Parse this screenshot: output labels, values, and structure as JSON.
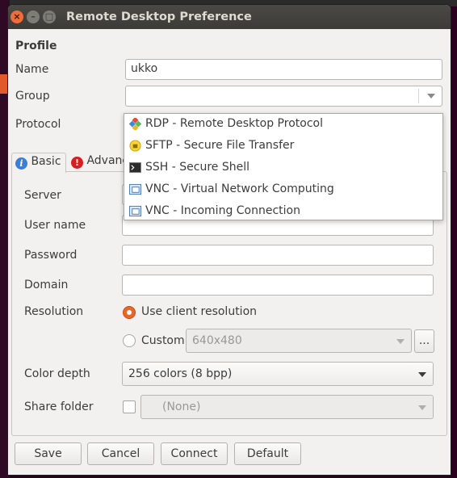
{
  "window": {
    "title": "Remote Desktop Preference"
  },
  "window_controls": {
    "close": "×",
    "minimize": "–",
    "maximize": "□"
  },
  "profile": {
    "section_title": "Profile",
    "name_label": "Name",
    "name_value": "ukko",
    "group_label": "Group",
    "group_value": "",
    "protocol_label": "Protocol"
  },
  "protocol_menu": {
    "items": [
      {
        "label": "RDP - Remote Desktop Protocol",
        "icon": "rdp-icon"
      },
      {
        "label": "SFTP - Secure File Transfer",
        "icon": "sftp-icon"
      },
      {
        "label": "SSH - Secure Shell",
        "icon": "terminal-icon"
      },
      {
        "label": "VNC - Virtual Network Computing",
        "icon": "vnc-icon"
      },
      {
        "label": "VNC - Incoming Connection",
        "icon": "vnc-incoming-icon"
      }
    ]
  },
  "tabs": [
    {
      "label": "Basic",
      "icon": "info-icon",
      "glyph": "i"
    },
    {
      "label": "Advanced",
      "icon": "error-icon",
      "glyph": "!"
    }
  ],
  "basic": {
    "server_label": "Server",
    "username_label": "User name",
    "password_label": "Password",
    "domain_label": "Domain",
    "resolution_label": "Resolution",
    "use_client_resolution": "Use client resolution",
    "custom_label": "Custom",
    "custom_value": "640x480",
    "custom_button": "...",
    "color_depth_label": "Color depth",
    "color_depth_value": "256 colors (8 bpp)",
    "share_folder_label": "Share folder",
    "share_folder_value": "(None)"
  },
  "buttons": {
    "save": "Save",
    "cancel": "Cancel",
    "connect": "Connect",
    "default": "Default"
  },
  "colors": {
    "accent": "#e9672b",
    "titlebar": "#3c3b37",
    "window_bg": "#f2f1f0"
  }
}
